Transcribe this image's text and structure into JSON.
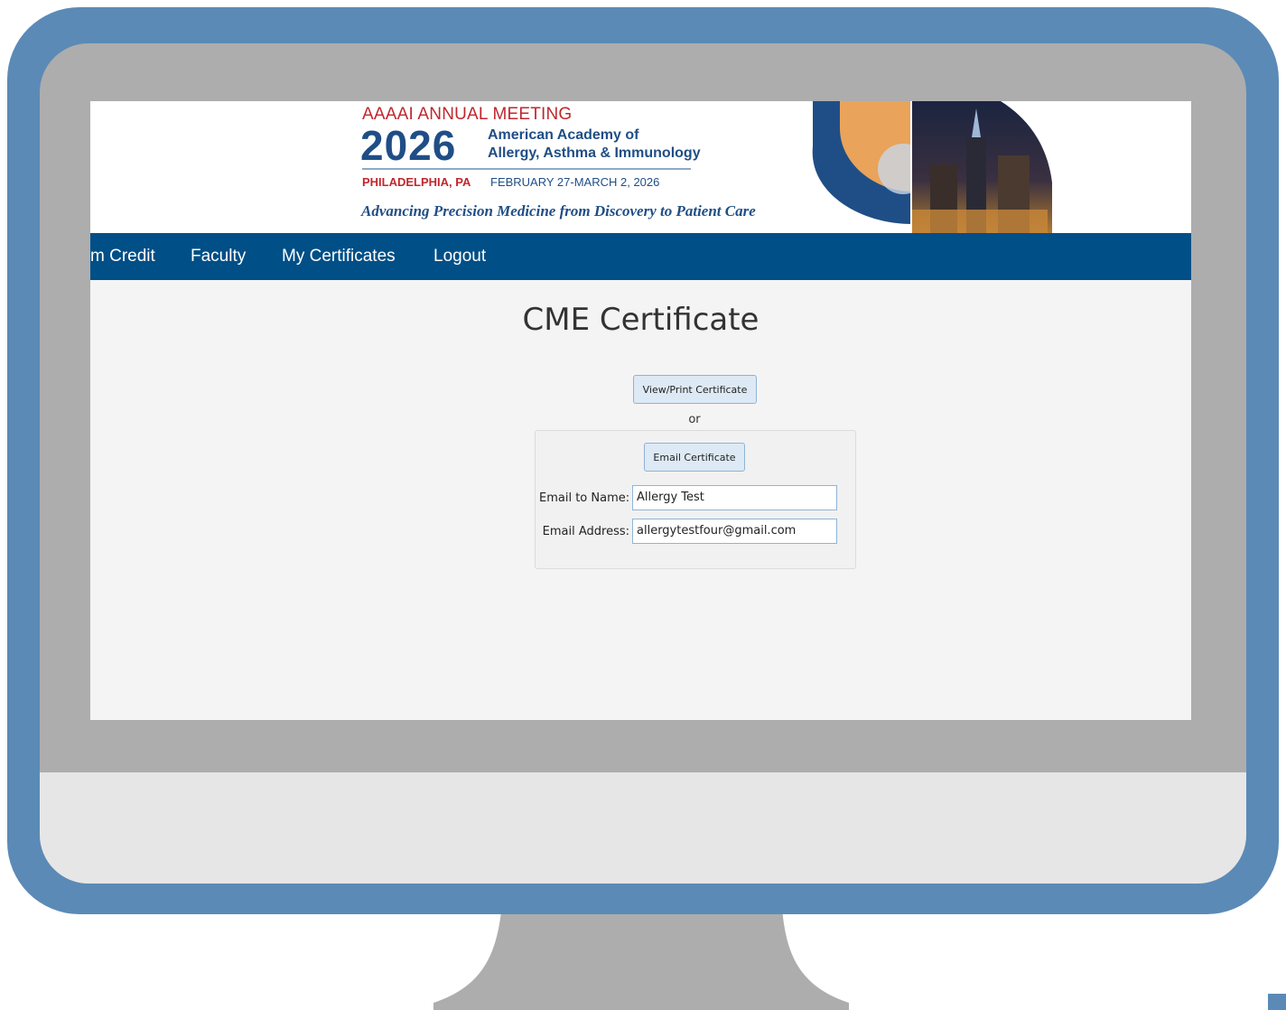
{
  "header": {
    "meeting_label": "AAAAI ANNUAL MEETING",
    "year": "2026",
    "org_line1": "American Academy of",
    "org_line2": "Allergy, Asthma & Immunology",
    "city": "PHILADELPHIA, PA",
    "dates": "FEBRUARY 27-MARCH 2, 2026",
    "tagline": "Advancing Precision Medicine from Discovery to Patient Care"
  },
  "nav": {
    "items": [
      {
        "label": "m Credit"
      },
      {
        "label": "Faculty"
      },
      {
        "label": "My Certificates"
      },
      {
        "label": "Logout"
      }
    ]
  },
  "main": {
    "title": "CME Certificate",
    "view_print_button": "View/Print Certificate",
    "or_text": "or",
    "email_button": "Email Certificate",
    "name_label": "Email to Name:",
    "name_value": "Allergy Test",
    "address_label": "Email Address:",
    "address_value": "allergytestfour@gmail.com"
  },
  "colors": {
    "bezel": "#5b8ab7",
    "navbar": "#004f87",
    "brand_blue": "#1f4e86",
    "brand_red": "#c0272d"
  }
}
